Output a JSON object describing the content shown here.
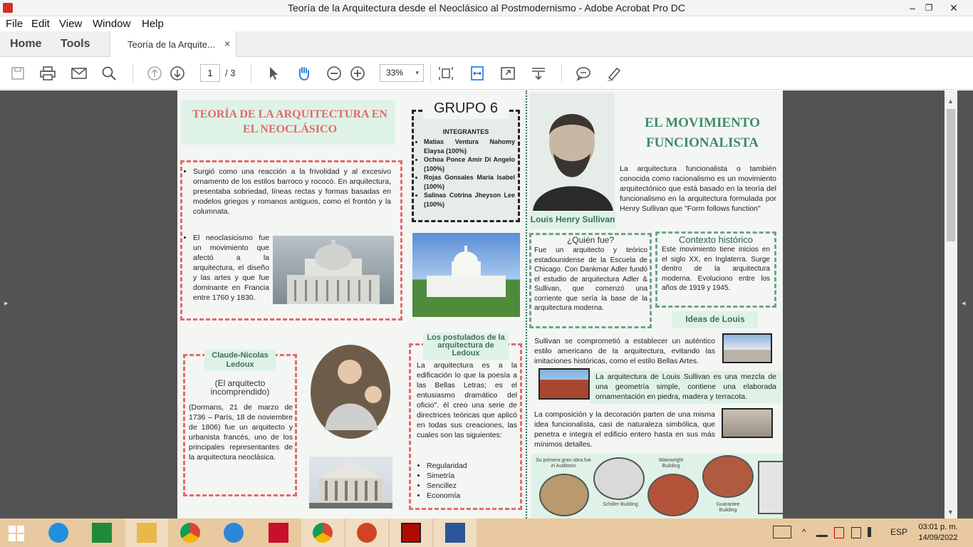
{
  "window": {
    "title": "Teoría de la Arquitectura desde el Neoclásico al Postmodernismo - Adobe Acrobat Pro DC",
    "minimize": "–",
    "maximize": "❐",
    "close": "✕"
  },
  "menu": [
    "File",
    "Edit",
    "View",
    "Window",
    "Help"
  ],
  "tabs": {
    "home": "Home",
    "tools": "Tools",
    "document_tab": "Teoría de la Arquite...",
    "close": "×"
  },
  "toolbar": {
    "current_page": "1",
    "total_pages": "/ 3",
    "zoom": "33%",
    "zoom_caret": "▾"
  },
  "viewer": {
    "left_arrow": "▸",
    "right_arrow": "◂",
    "scroll_up": "▲",
    "scroll_down": "▼"
  },
  "doc": {
    "left_title": "TEORÍA DE LA ARQUITECTURA EN EL NEOCLÁSICO",
    "group_title": "GRUPO 6",
    "members_header": "INTEGRANTES",
    "members": [
      "Matias Ventura Nahomy Elaysa (100%)",
      "Ochoa Ponce Amir Di Angelo (100%)",
      "Rojas Gonsales Maria Isabel (100%)",
      "Salinas Cotrina Jheyson Lee (100%)"
    ],
    "bullet1": "Surgió como una reacción a la frivolidad y al excesivo ornamento de los estilos barroco y rococó. En arquitectura, presentaba sobriedad, líneas rectas y formas basadas en modelos griegos y romanos antiguos, como el frontón y la columnata.",
    "bullet2": "El neoclasicismo fue un movimiento que afectó a la arquitectura, el diseño y las artes y que fue dominante en Francia entre 1760 y 1830.",
    "ledoux_name": "Claude-Nicolas Ledoux",
    "ledoux_subtitle": "(El arquitecto incomprendido)",
    "ledoux_bio": "(Dormans, 21 de marzo de 1736 – París, 18 de noviembre de 1806) fue un arquitecto y urbanista francés, uno de los principales representantes de la arquitectura neoclásica.",
    "postulados_title": "Los postulados de la arquitectura de Ledoux",
    "postulados_text": "La arquitectura es a la edificación lo que la poesía a las Bellas Letras; es el entusiasmo dramático del oficio\". él creo una serie de directrices teóricas que aplicó en todas sus creaciones, las cuales son las siguientes:",
    "postulados_list": [
      "Regularidad",
      "Simetría",
      "Sencillez",
      "Economía"
    ],
    "right_title": "EL MOVIMIENTO FUNCIONALISTA",
    "intro": "La arquitectura funcionalista o también conocida como racionalismo es un movimiento arquitectónico que está basado en la teoría del funcionalismo en la arquitectura formulada por Henry Sullivan que \"Form follows function\"",
    "sullivan_label": "Louis Henry Sullivan",
    "quien_title": "¿Quién fue?",
    "quien_text": "Fue un arquitecto y teórico estadounidense de la Escuela de Chicago. Con Dankmar Adler fundó el estudio de arquitectura Adler & Sullivan, que comenzó una corriente que sería la base de la arquitectura moderna.",
    "contexto_title": "Contexto histórico",
    "contexto_text": "Este movimiento tiene inicios en el siglo XX, en Inglaterra. Surge dentro de la arquitectura moderna. Evoluciono entre los años de 1919 y 1945.",
    "ideas_title": "Ideas de Louis",
    "idea1": "Sullivan se comprometió a establecer un auténtico estilo americano de la arquitectura, evitando las imitaciones históricas, como el estilo Bellas Artes.",
    "idea2": "La arquitectura de Louis Sullivan es una mezcla de una geometría simple, contiene una elaborada ornamentación en piedra, madera y terracota.",
    "idea3": "La composición y la decoración parten de una misma idea funcionalista, casi de naturaleza simbólica, que penetra e integra el edificio entero hasta en sus más mínimos detalles.",
    "buildings": {
      "auditorio": "Su primera gran obra fue el Auditorio",
      "schiller": "Schiller Building",
      "wainwright": "Wainwright Building",
      "guarantee": "Guarantee Building"
    }
  },
  "taskbar": {
    "language": "ESP",
    "time": "03:01 p. m.",
    "date": "14/09/2022",
    "tray_up": "^"
  },
  "colors": {
    "accent_red": "#e06b6b",
    "accent_green": "#3f8a6c",
    "taskbar": "#e8c9a0",
    "viewer_bg": "#535353"
  }
}
